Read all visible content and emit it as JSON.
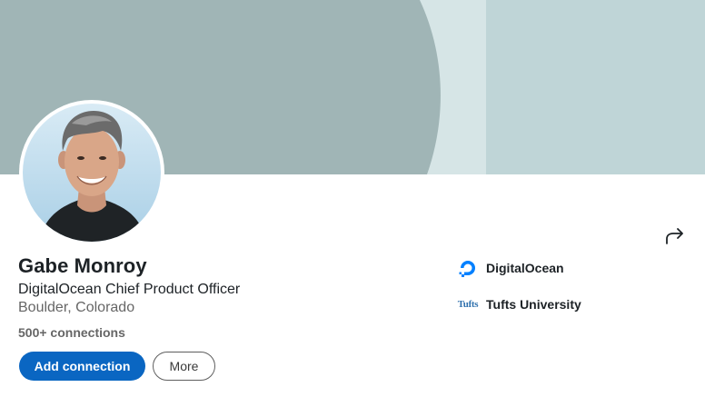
{
  "profile": {
    "name": "Gabe Monroy",
    "headline": "DigitalOcean Chief Product Officer",
    "location": "Boulder, Colorado",
    "connections": "500+ connections"
  },
  "actions": {
    "primary_label": "Add connection",
    "secondary_label": "More"
  },
  "organizations": [
    {
      "name": "DigitalOcean",
      "logo": "digitalocean-logo-icon"
    },
    {
      "name": "Tufts University",
      "logo": "tufts-logo",
      "logo_text": "Tufts"
    }
  ],
  "icons": {
    "share": "share-icon"
  },
  "colors": {
    "primary_button": "#0a66c2",
    "cover_dark": "#a0b5b6",
    "cover_light": "#bfd5d7",
    "cover_mid": "#d6e5e6",
    "digitalocean_blue": "#0080ff"
  }
}
